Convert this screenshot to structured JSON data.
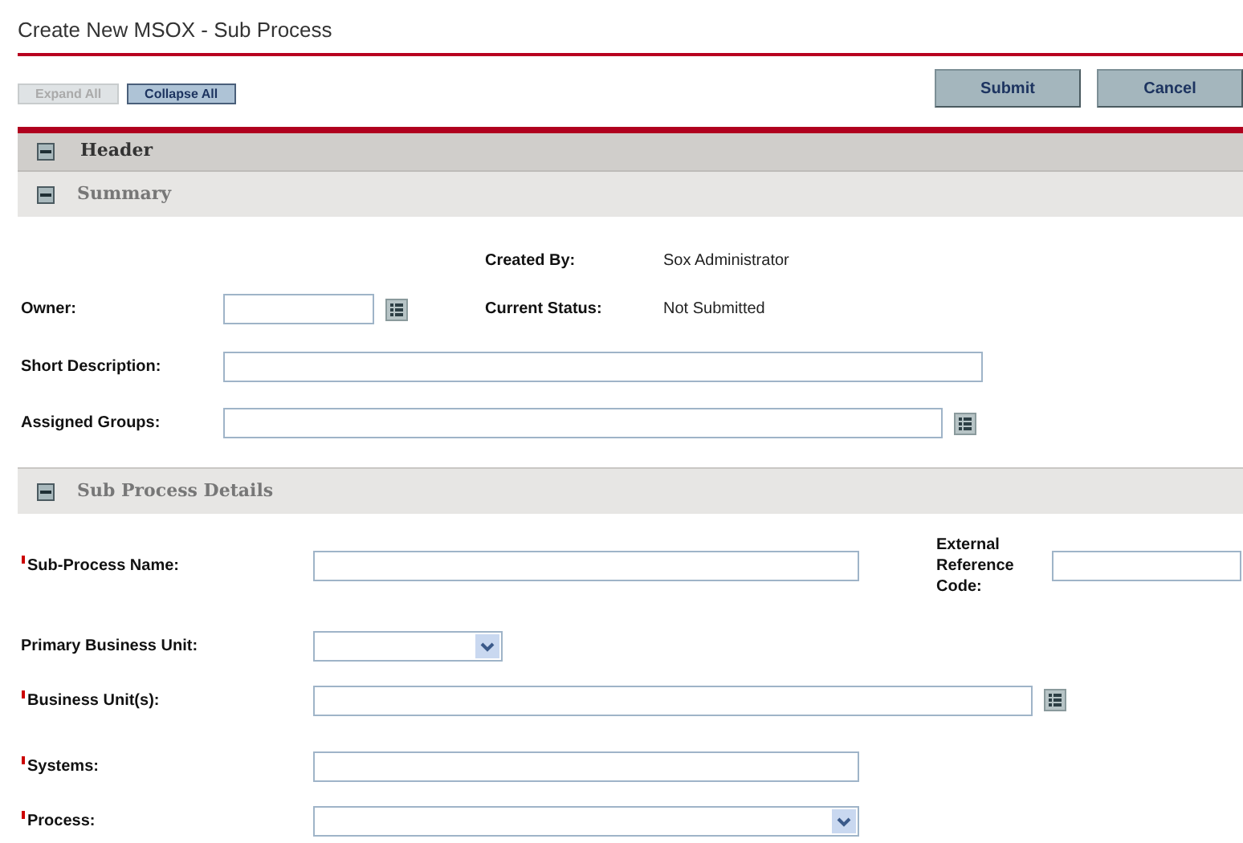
{
  "title": "Create New MSOX - Sub Process",
  "toolbar": [
    {
      "label": "Expand All",
      "disabled": true
    },
    {
      "label": "Collapse All",
      "disabled": false
    }
  ],
  "actions": [
    {
      "label": "Submit"
    },
    {
      "label": "Cancel"
    }
  ],
  "header_section": {
    "label": "Header",
    "expanded": true
  },
  "summary": {
    "label": "Summary",
    "expanded": true,
    "created_by": {
      "label": "Created By:",
      "value": "Sox Administrator"
    },
    "owner": {
      "label": "Owner:"
    },
    "current_status": {
      "label": "Current Status:",
      "value": "Not Submitted"
    },
    "short_description": {
      "label": "Short Description:"
    },
    "assigned_groups": {
      "label": "Assigned Groups:"
    }
  },
  "details": {
    "label": "Sub Process Details",
    "expanded": true,
    "fields": [
      {
        "kind": "text",
        "label": "Sub-Process Name:",
        "required": true
      },
      {
        "kind": "select",
        "label": "Primary Business Unit:",
        "required": false
      },
      {
        "kind": "lookup",
        "label": "Business Unit(s):",
        "required": true
      },
      {
        "kind": "text",
        "label": "Systems:",
        "required": true
      },
      {
        "kind": "select",
        "label": "Process:",
        "required": true
      }
    ],
    "external_reference": {
      "label": "External Reference Code:"
    }
  }
}
